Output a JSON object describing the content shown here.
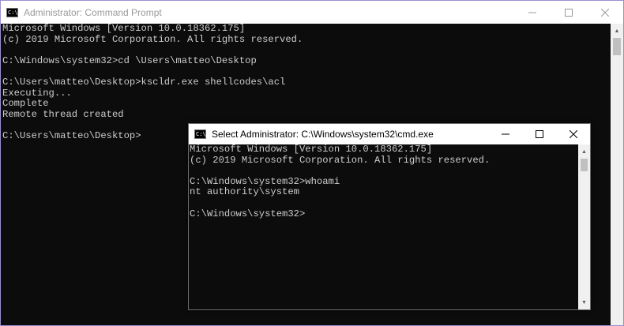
{
  "main_window": {
    "title": "Administrator: Command Prompt",
    "console_text": "Microsoft Windows [Version 10.0.18362.175]\n(c) 2019 Microsoft Corporation. All rights reserved.\n\nC:\\Windows\\system32>cd \\Users\\matteo\\Desktop\n\nC:\\Users\\matteo\\Desktop>kscldr.exe shellcodes\\acl\nExecuting...\nComplete\nRemote thread created\n\nC:\\Users\\matteo\\Desktop>",
    "icon": "cmd-icon",
    "controls": [
      "minimize-icon",
      "maximize-icon",
      "close-icon"
    ]
  },
  "child_window": {
    "title": "Select Administrator: C:\\Windows\\system32\\cmd.exe",
    "console_text": "Microsoft Windows [Version 10.0.18362.175]\n(c) 2019 Microsoft Corporation. All rights reserved.\n\nC:\\Windows\\system32>whoami\nnt authority\\system\n\nC:\\Windows\\system32>",
    "icon": "cmd-icon",
    "controls": [
      "minimize-icon",
      "maximize-icon",
      "close-icon"
    ]
  },
  "icon_glyph": "C:\\"
}
